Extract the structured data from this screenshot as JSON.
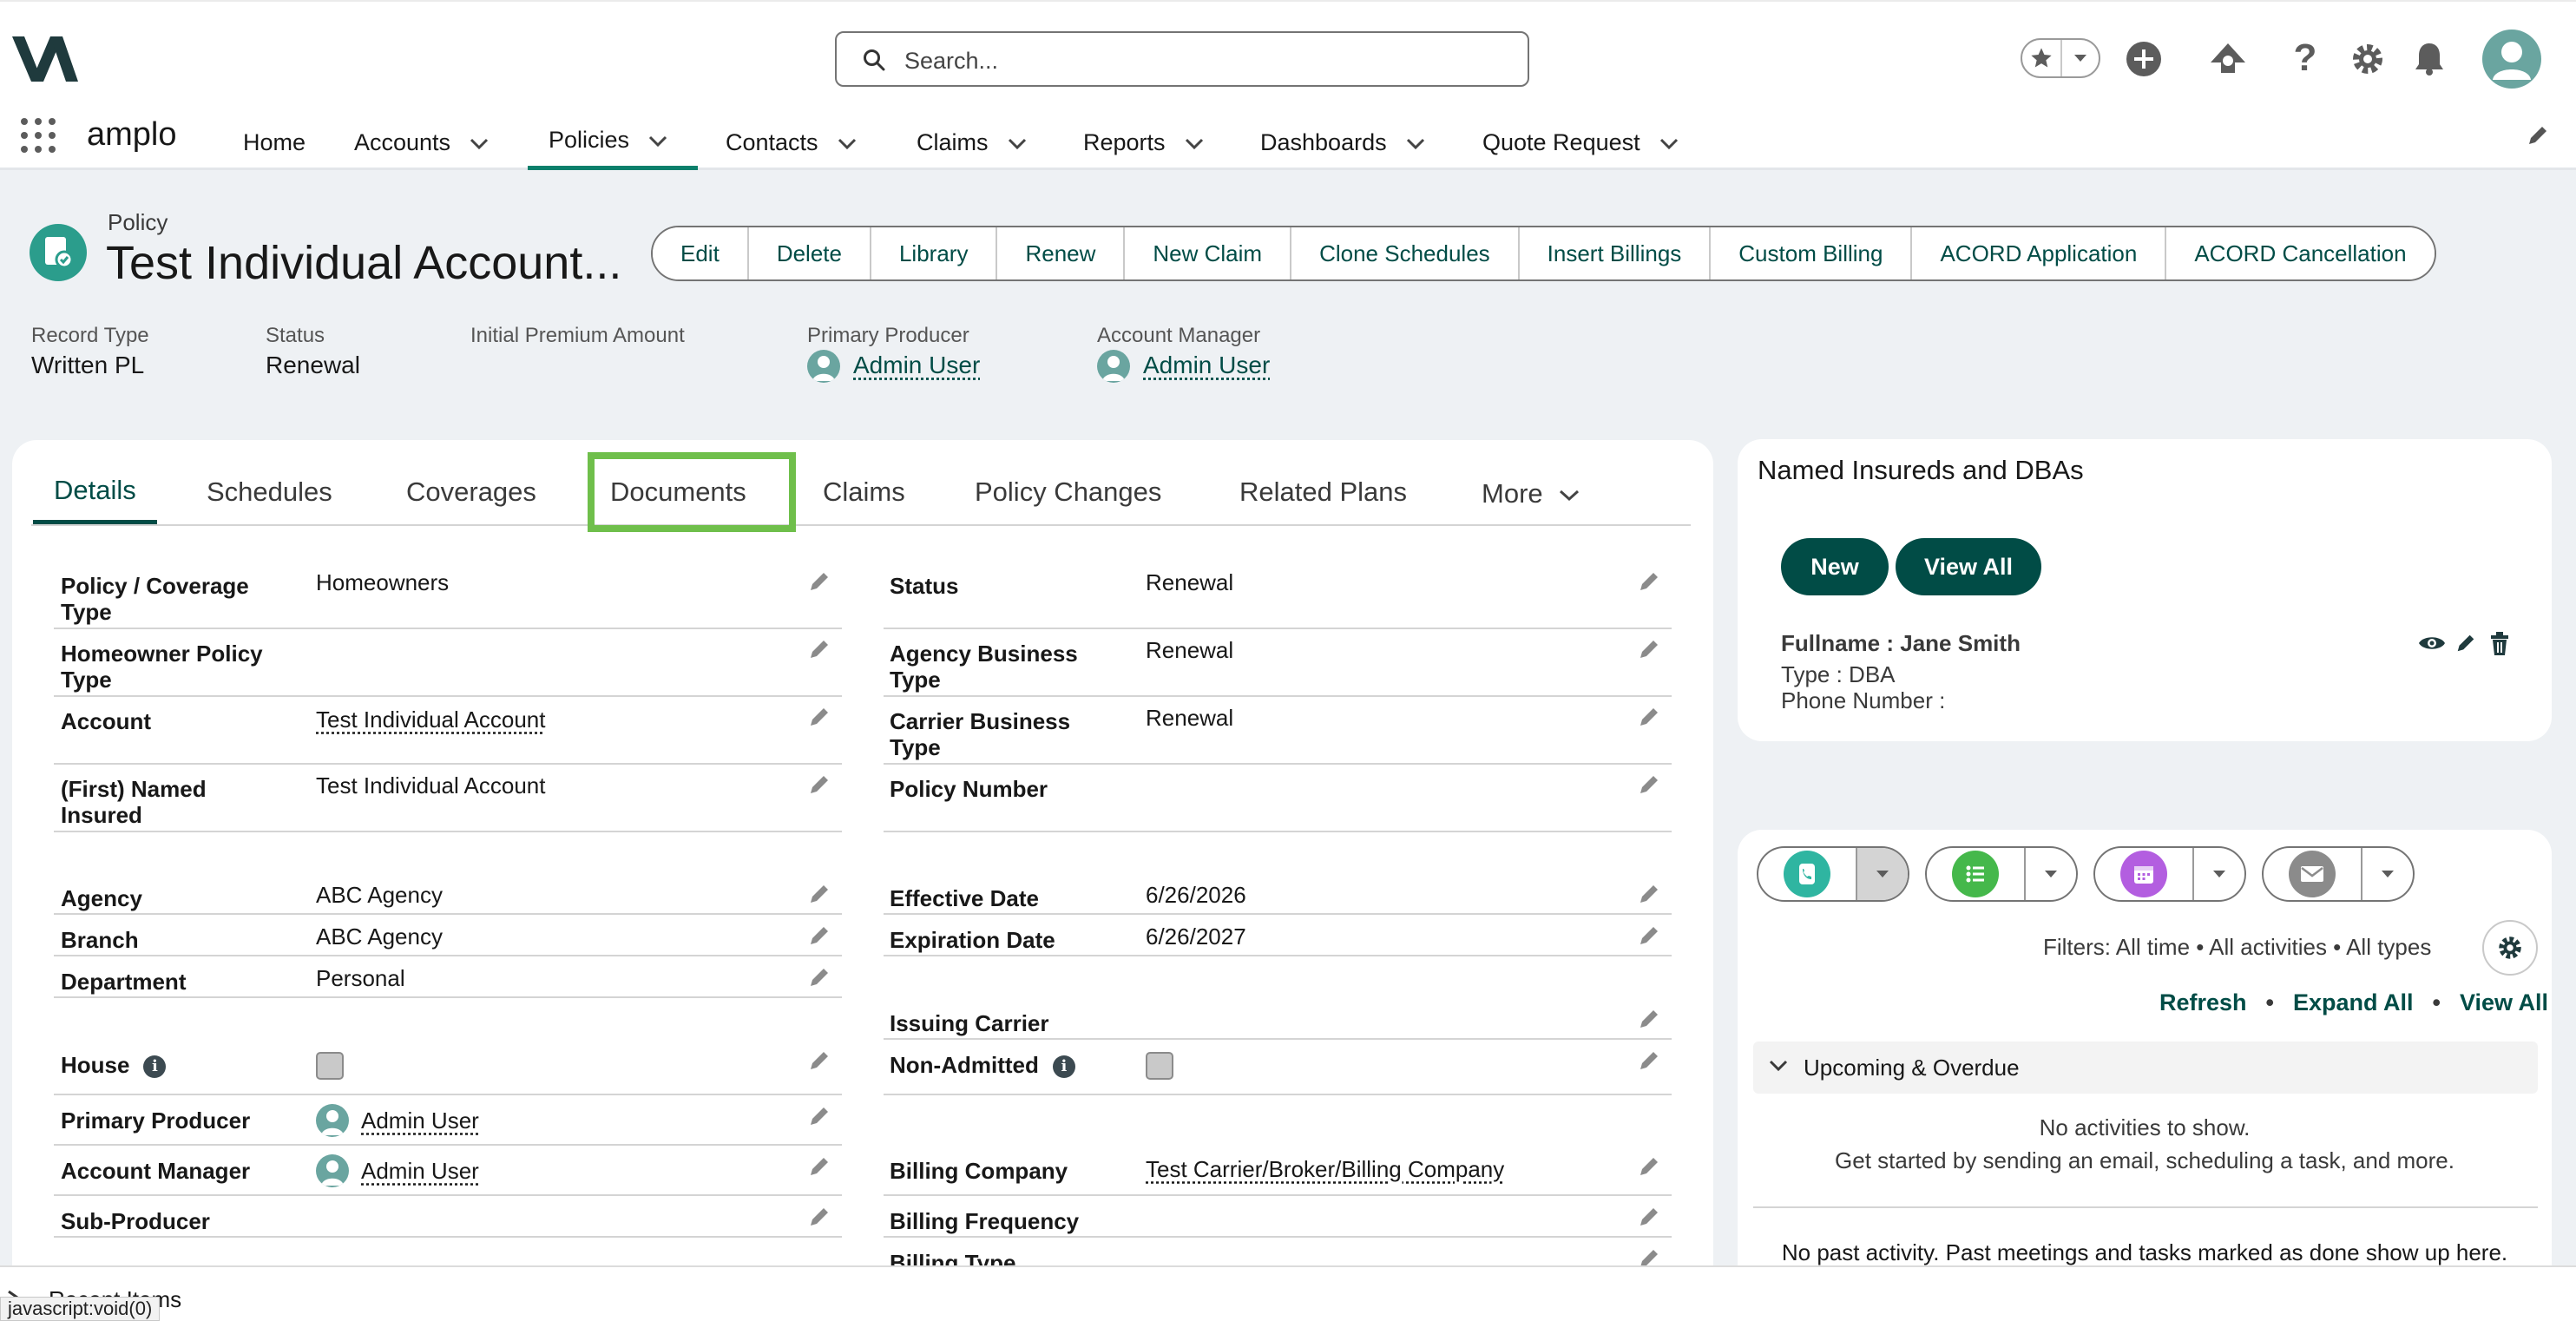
{
  "header": {
    "search_placeholder": "Search...",
    "icons": [
      "favorites-star-icon",
      "add-icon",
      "trailhead-icon",
      "help-icon",
      "setup-gear-icon",
      "notifications-bell-icon",
      "user-avatar"
    ]
  },
  "nav": {
    "app_name": "amplo",
    "items": [
      {
        "label": "Home",
        "has_menu": false,
        "active": false
      },
      {
        "label": "Accounts",
        "has_menu": true,
        "active": false
      },
      {
        "label": "Policies",
        "has_menu": true,
        "active": true
      },
      {
        "label": "Contacts",
        "has_menu": true,
        "active": false
      },
      {
        "label": "Claims",
        "has_menu": true,
        "active": false
      },
      {
        "label": "Reports",
        "has_menu": true,
        "active": false
      },
      {
        "label": "Dashboards",
        "has_menu": true,
        "active": false
      },
      {
        "label": "Quote Request",
        "has_menu": true,
        "active": false
      }
    ]
  },
  "record": {
    "object_label": "Policy",
    "title": "Test Individual Account...",
    "actions": [
      "Edit",
      "Delete",
      "Library",
      "Renew",
      "New Claim",
      "Clone Schedules",
      "Insert Billings",
      "Custom Billing",
      "ACORD Application",
      "ACORD Cancellation"
    ],
    "highlights": {
      "record_type_label": "Record Type",
      "record_type_value": "Written PL",
      "status_label": "Status",
      "status_value": "Renewal",
      "initial_premium_label": "Initial Premium Amount",
      "initial_premium_value": "",
      "primary_producer_label": "Primary Producer",
      "primary_producer_value": "Admin User",
      "account_manager_label": "Account Manager",
      "account_manager_value": "Admin User"
    }
  },
  "tabs": {
    "items": [
      "Details",
      "Schedules",
      "Coverages",
      "Documents",
      "Claims",
      "Policy Changes",
      "Related Plans"
    ],
    "more_label": "More",
    "active": "Details",
    "highlighted": "Documents"
  },
  "details": {
    "left": {
      "policy_coverage_type_label": "Policy / Coverage Type",
      "policy_coverage_type_value": "Homeowners",
      "homeowner_policy_type_label": "Homeowner Policy Type",
      "homeowner_policy_type_value": "",
      "account_label": "Account",
      "account_value": "Test Individual Account",
      "first_named_insured_label": "(First) Named Insured",
      "first_named_insured_value": "Test Individual Account",
      "agency_label": "Agency",
      "agency_value": "ABC Agency",
      "branch_label": "Branch",
      "branch_value": "ABC Agency",
      "department_label": "Department",
      "department_value": "Personal",
      "house_label": "House",
      "house_checked": false,
      "primary_producer_label": "Primary Producer",
      "primary_producer_value": "Admin User",
      "account_manager_label": "Account Manager",
      "account_manager_value": "Admin User",
      "sub_producer_label": "Sub-Producer",
      "sub_producer_value": ""
    },
    "right": {
      "status_label": "Status",
      "status_value": "Renewal",
      "agency_business_type_label": "Agency Business Type",
      "agency_business_type_value": "Renewal",
      "carrier_business_type_label": "Carrier Business Type",
      "carrier_business_type_value": "Renewal",
      "policy_number_label": "Policy Number",
      "policy_number_value": "",
      "effective_date_label": "Effective Date",
      "effective_date_value": "6/26/2026",
      "expiration_date_label": "Expiration Date",
      "expiration_date_value": "6/26/2027",
      "issuing_carrier_label": "Issuing Carrier",
      "issuing_carrier_value": "",
      "non_admitted_label": "Non-Admitted",
      "non_admitted_checked": false,
      "billing_company_label": "Billing Company",
      "billing_company_value": "Test Carrier/Broker/Billing Company",
      "billing_frequency_label": "Billing Frequency",
      "billing_frequency_value": "",
      "billing_type_label": "Billing Type"
    }
  },
  "named_insureds": {
    "title": "Named Insureds and DBAs",
    "new_label": "New",
    "view_all_label": "View All",
    "entry": {
      "fullname": "Fullname : Jane Smith",
      "type": "Type : DBA",
      "phone": "Phone Number :"
    }
  },
  "activity": {
    "filters_text": "Filters: All time • All activities • All types",
    "refresh_label": "Refresh",
    "expand_all_label": "Expand All",
    "view_all_label": "View All",
    "separator": "•",
    "upcoming_label": "Upcoming & Overdue",
    "no_activities": "No activities to show.",
    "get_started": "Get started by sending an email, scheduling a task, and more.",
    "no_past": "No past activity. Past meetings and tasks marked as done show up here.",
    "colors": {
      "call": "#2fb5a1",
      "task": "#45b84b",
      "event": "#b35ee0",
      "email": "#8b8b8b"
    }
  },
  "footer": {
    "recent_items_label": "Recent Items",
    "status_url": "javascript:void(0)"
  },
  "colors": {
    "brand": "#014c46",
    "nav_active": "#0b7f6b",
    "highlight": "#6fbf4b"
  }
}
